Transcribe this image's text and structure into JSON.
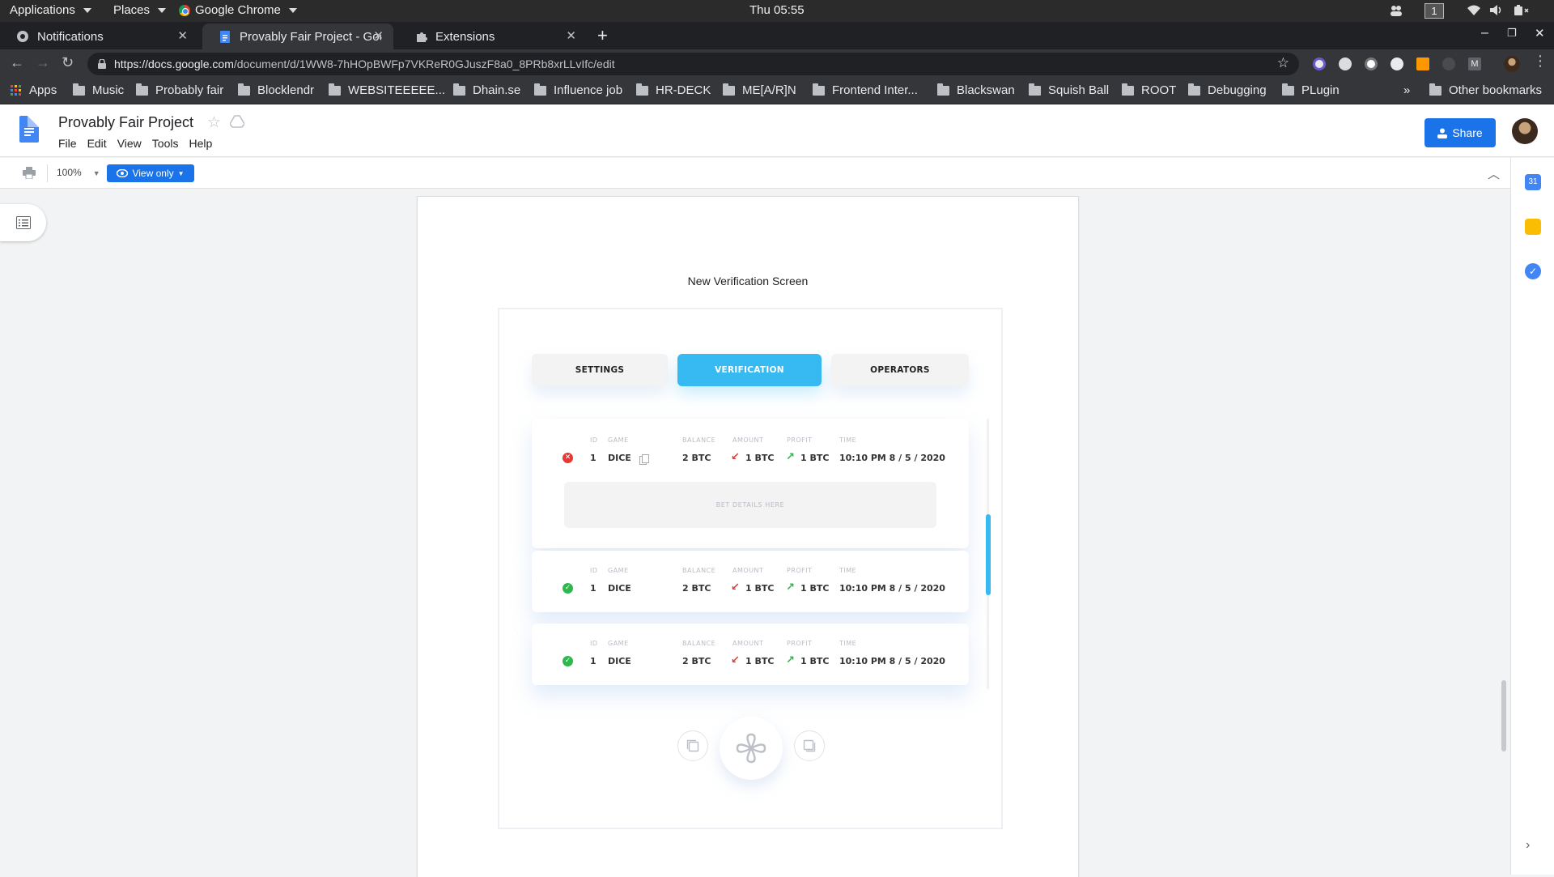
{
  "os_bar": {
    "applications": "Applications",
    "places": "Places",
    "browser": "Google Chrome",
    "clock": "Thu 05:55",
    "workspace": "1"
  },
  "tabs": [
    {
      "title": "Notifications",
      "icon": "github-icon"
    },
    {
      "title": "Provably Fair Project - Goo",
      "icon": "docs-icon"
    },
    {
      "title": "Extensions",
      "icon": "puzzle-icon"
    }
  ],
  "address_bar": {
    "url_host": "https://docs.google.com",
    "url_path": "/document/d/1WW8-7hHOpBWFp7VKReR0GJuszF8a0_8PRb8xrLLvIfc/edit"
  },
  "bookmarks": [
    {
      "label": "Apps"
    },
    {
      "label": "Music"
    },
    {
      "label": "Probably fair"
    },
    {
      "label": "Blocklendr"
    },
    {
      "label": "WEBSITEEEEE..."
    },
    {
      "label": "Dhain.se"
    },
    {
      "label": "Influence job"
    },
    {
      "label": "HR-DECK"
    },
    {
      "label": "ME[A/R]N"
    },
    {
      "label": "Frontend Inter..."
    },
    {
      "label": "Blackswan"
    },
    {
      "label": "Squish Ball"
    },
    {
      "label": "ROOT"
    },
    {
      "label": "Debugging"
    },
    {
      "label": "PLugin"
    }
  ],
  "bookmarks_more": "»",
  "other_bookmarks": "Other bookmarks",
  "docs": {
    "title": "Provably Fair Project",
    "menu": [
      "File",
      "Edit",
      "View",
      "Tools",
      "Help"
    ],
    "share_label": "Share",
    "zoom": "100%",
    "view_only_label": "View only"
  },
  "document": {
    "heading": "New Verification Screen"
  },
  "mockup": {
    "tabs": [
      "SETTINGS",
      "VERIFICATION",
      "OPERATORS"
    ],
    "columns": [
      "ID",
      "GAME",
      "BALANCE",
      "AMOUNT",
      "PROFIT",
      "TIME"
    ],
    "rows": [
      {
        "status": "fail",
        "status_glyph": "✕",
        "id": "1",
        "game": "DICE",
        "balance": "2 BTC",
        "amount": "1 BTC",
        "profit": "1 BTC",
        "time": "10:10 PM 8 / 5 / 2020"
      },
      {
        "status": "ok",
        "status_glyph": "✓",
        "id": "1",
        "game": "DICE",
        "balance": "2 BTC",
        "amount": "1 BTC",
        "profit": "1 BTC",
        "time": "10:10 PM 8 / 5 / 2020"
      },
      {
        "status": "ok",
        "status_glyph": "✓",
        "id": "1",
        "game": "DICE",
        "balance": "2 BTC",
        "amount": "1 BTC",
        "profit": "1 BTC",
        "time": "10:10 PM 8 / 5 / 2020"
      }
    ],
    "bet_details": "BET DETAILS HERE",
    "accent_color": "#37b9f1",
    "fail_color": "#e53935",
    "ok_color": "#2eb84b"
  }
}
